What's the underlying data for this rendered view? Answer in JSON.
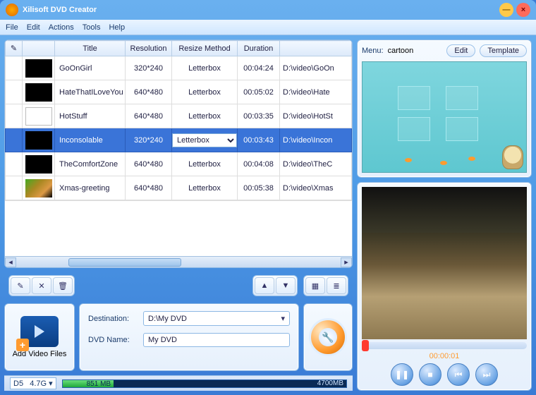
{
  "window": {
    "title": "Xilisoft DVD Creator"
  },
  "menu": {
    "items": [
      "File",
      "Edit",
      "Actions",
      "Tools",
      "Help"
    ]
  },
  "columns": [
    "",
    "",
    "Title",
    "Resolution",
    "Resize Method",
    "Duration",
    ""
  ],
  "path_prefix": "D:\\video\\",
  "rows": [
    {
      "title": "GoOnGirl",
      "res": "320*240",
      "method": "Letterbox",
      "dur": "00:04:24",
      "path": "D:\\video\\GoOn",
      "thumb": "black"
    },
    {
      "title": "HateThatILoveYou",
      "res": "640*480",
      "method": "Letterbox",
      "dur": "00:05:02",
      "path": "D:\\video\\Hate",
      "thumb": "black"
    },
    {
      "title": "HotStuff",
      "res": "640*480",
      "method": "Letterbox",
      "dur": "00:03:35",
      "path": "D:\\video\\HotSt",
      "thumb": "white"
    },
    {
      "title": "Inconsolable",
      "res": "320*240",
      "method": "Letterbox",
      "dur": "00:03:43",
      "path": "D:\\video\\Incon",
      "thumb": "black",
      "selected": true
    },
    {
      "title": "TheComfortZone",
      "res": "640*480",
      "method": "Letterbox",
      "dur": "00:04:08",
      "path": "D:\\video\\TheC",
      "thumb": "black"
    },
    {
      "title": "Xmas-greeting",
      "res": "640*480",
      "method": "Letterbox",
      "dur": "00:05:38",
      "path": "D:\\video\\Xmas",
      "thumb": "pic"
    }
  ],
  "selected_method": "Letterbox",
  "add_label": "Add Video Files",
  "dest": {
    "label": "Destination:",
    "value": "D:\\My DVD"
  },
  "dvdname": {
    "label": "DVD Name:",
    "value": "My DVD"
  },
  "status": {
    "disc": "D5",
    "size": "4.7G",
    "used": "851 MB",
    "cap": "4700MB"
  },
  "menupane": {
    "label": "Menu:",
    "template": "cartoon",
    "edit": "Edit",
    "templ": "Template"
  },
  "preview": {
    "time": "00:00:01"
  }
}
